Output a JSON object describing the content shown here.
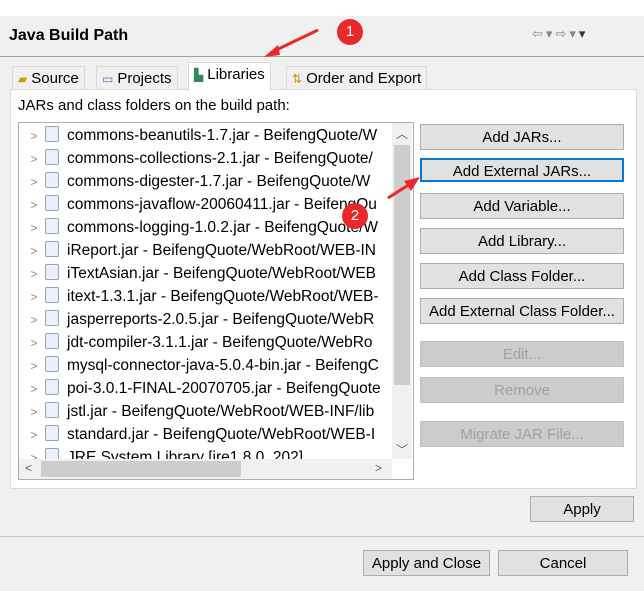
{
  "header": {
    "title": "Java Build Path"
  },
  "tabs": [
    {
      "label": "Source",
      "icon": "source-folder-icon"
    },
    {
      "label": "Projects",
      "icon": "projects-folder-icon"
    },
    {
      "label": "Libraries",
      "icon": "libraries-icon",
      "active": true
    },
    {
      "label": "Order and Export",
      "icon": "order-export-icon"
    }
  ],
  "panel": {
    "label": "JARs and class folders on the build path:"
  },
  "list": {
    "items": [
      "commons-beanutils-1.7.jar - BeifengQuote/W",
      "commons-collections-2.1.jar - BeifengQuote/",
      "commons-digester-1.7.jar - BeifengQuote/W",
      "commons-javaflow-20060411.jar - BeifengQu",
      "commons-logging-1.0.2.jar - BeifengQuote/W",
      "iReport.jar - BeifengQuote/WebRoot/WEB-IN",
      "iTextAsian.jar - BeifengQuote/WebRoot/WEB",
      "itext-1.3.1.jar - BeifengQuote/WebRoot/WEB-",
      "jasperreports-2.0.5.jar - BeifengQuote/WebR",
      "jdt-compiler-3.1.1.jar - BeifengQuote/WebRo",
      "mysql-connector-java-5.0.4-bin.jar - BeifengC",
      "poi-3.0.1-FINAL-20070705.jar - BeifengQuote",
      "jstl.jar - BeifengQuote/WebRoot/WEB-INF/lib",
      "standard.jar - BeifengQuote/WebRoot/WEB-I",
      "JRE System Library [jre1.8.0_202]"
    ]
  },
  "buttons": {
    "add_jars": "Add JARs...",
    "add_external_jars": "Add External JARs...",
    "add_variable": "Add Variable...",
    "add_library": "Add Library...",
    "add_class_folder": "Add Class Folder...",
    "add_external_class_folder": "Add External Class Folder...",
    "edit": "Edit...",
    "remove": "Remove",
    "migrate": "Migrate JAR File...",
    "apply": "Apply",
    "apply_and_close": "Apply and Close",
    "cancel": "Cancel"
  },
  "annotations": {
    "step1": "1",
    "step2": "2",
    "color": "#e8282a"
  },
  "colors": {
    "focus": "#0078d7"
  }
}
